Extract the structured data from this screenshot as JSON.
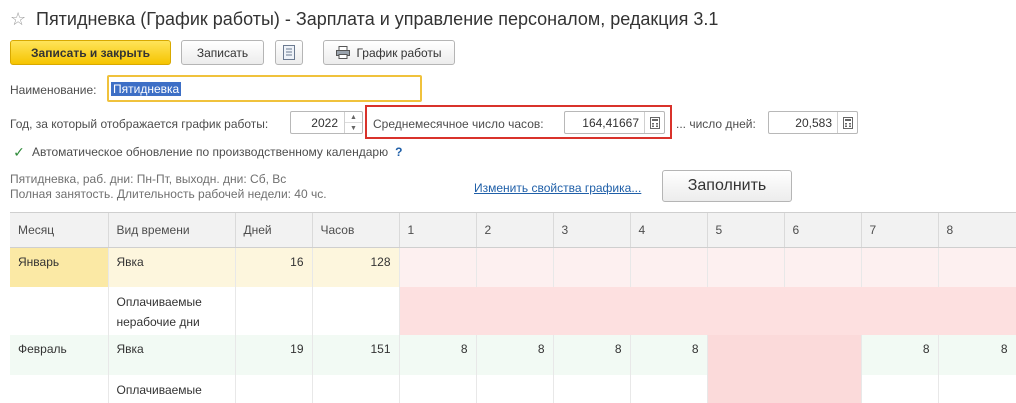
{
  "window": {
    "title": "Пятидневка (График работы) - Зарплата и управление персоналом, редакция 3.1"
  },
  "toolbar": {
    "save_close_label": "Записать и закрыть",
    "save_label": "Записать",
    "list_icon": "list-icon",
    "print_label": "График работы",
    "print_icon": "printer-icon"
  },
  "form": {
    "name_label": "Наименование:",
    "name_value": "Пятидневка",
    "year_label": "Год, за который отображается график работы:",
    "year_value": "2022",
    "avg_hours_label": "Среднемесячное число часов:",
    "avg_hours_value": "164,41667",
    "avg_days_label": "... число дней:",
    "avg_days_value": "20,583",
    "auto_update_label": "Автоматическое обновление по производственному календарю",
    "auto_update_checked": true,
    "help_mark": "?",
    "info_line1": "Пятидневка, раб. дни: Пн-Пт, выходн. дни: Сб, Вс",
    "info_line2": "Полная занятость. Длительность рабочей недели: 40 чс.",
    "change_props_link": "Изменить свойства графика...",
    "fill_button": "Заполнить"
  },
  "grid": {
    "headers": [
      "Месяц",
      "Вид времени",
      "Дней",
      "Часов",
      "1",
      "2",
      "3",
      "4",
      "5",
      "6",
      "7",
      "8"
    ],
    "rows": [
      {
        "month": "Январь",
        "kind": "Явка",
        "days": "16",
        "hours": "128",
        "cells": [
          "",
          "",
          "",
          "",
          "",
          "",
          "",
          ""
        ]
      },
      {
        "month": "",
        "kind": "Оплачиваемые нерабочие дни",
        "days": "",
        "hours": "",
        "cells": [
          "",
          "",
          "",
          "",
          "",
          "",
          "",
          ""
        ]
      },
      {
        "month": "Февраль",
        "kind": "Явка",
        "days": "19",
        "hours": "151",
        "cells": [
          "8",
          "8",
          "8",
          "8",
          "",
          "",
          "8",
          "8"
        ]
      },
      {
        "month": "",
        "kind": "Оплачиваемые",
        "days": "",
        "hours": "",
        "cells": [
          "",
          "",
          "",
          "",
          "",
          "",
          "",
          ""
        ]
      }
    ]
  },
  "colors": {
    "accent_yellow": "#f5c400",
    "highlight_red": "#d9322b",
    "january_selected": "#fbe9a5",
    "january_row": "#fdf6dd",
    "holiday_light": "#fdf0f0",
    "holiday": "#fde0e0",
    "weekend": "#fbdada",
    "february_row": "#f2faf4",
    "link": "#1f5fa8"
  }
}
